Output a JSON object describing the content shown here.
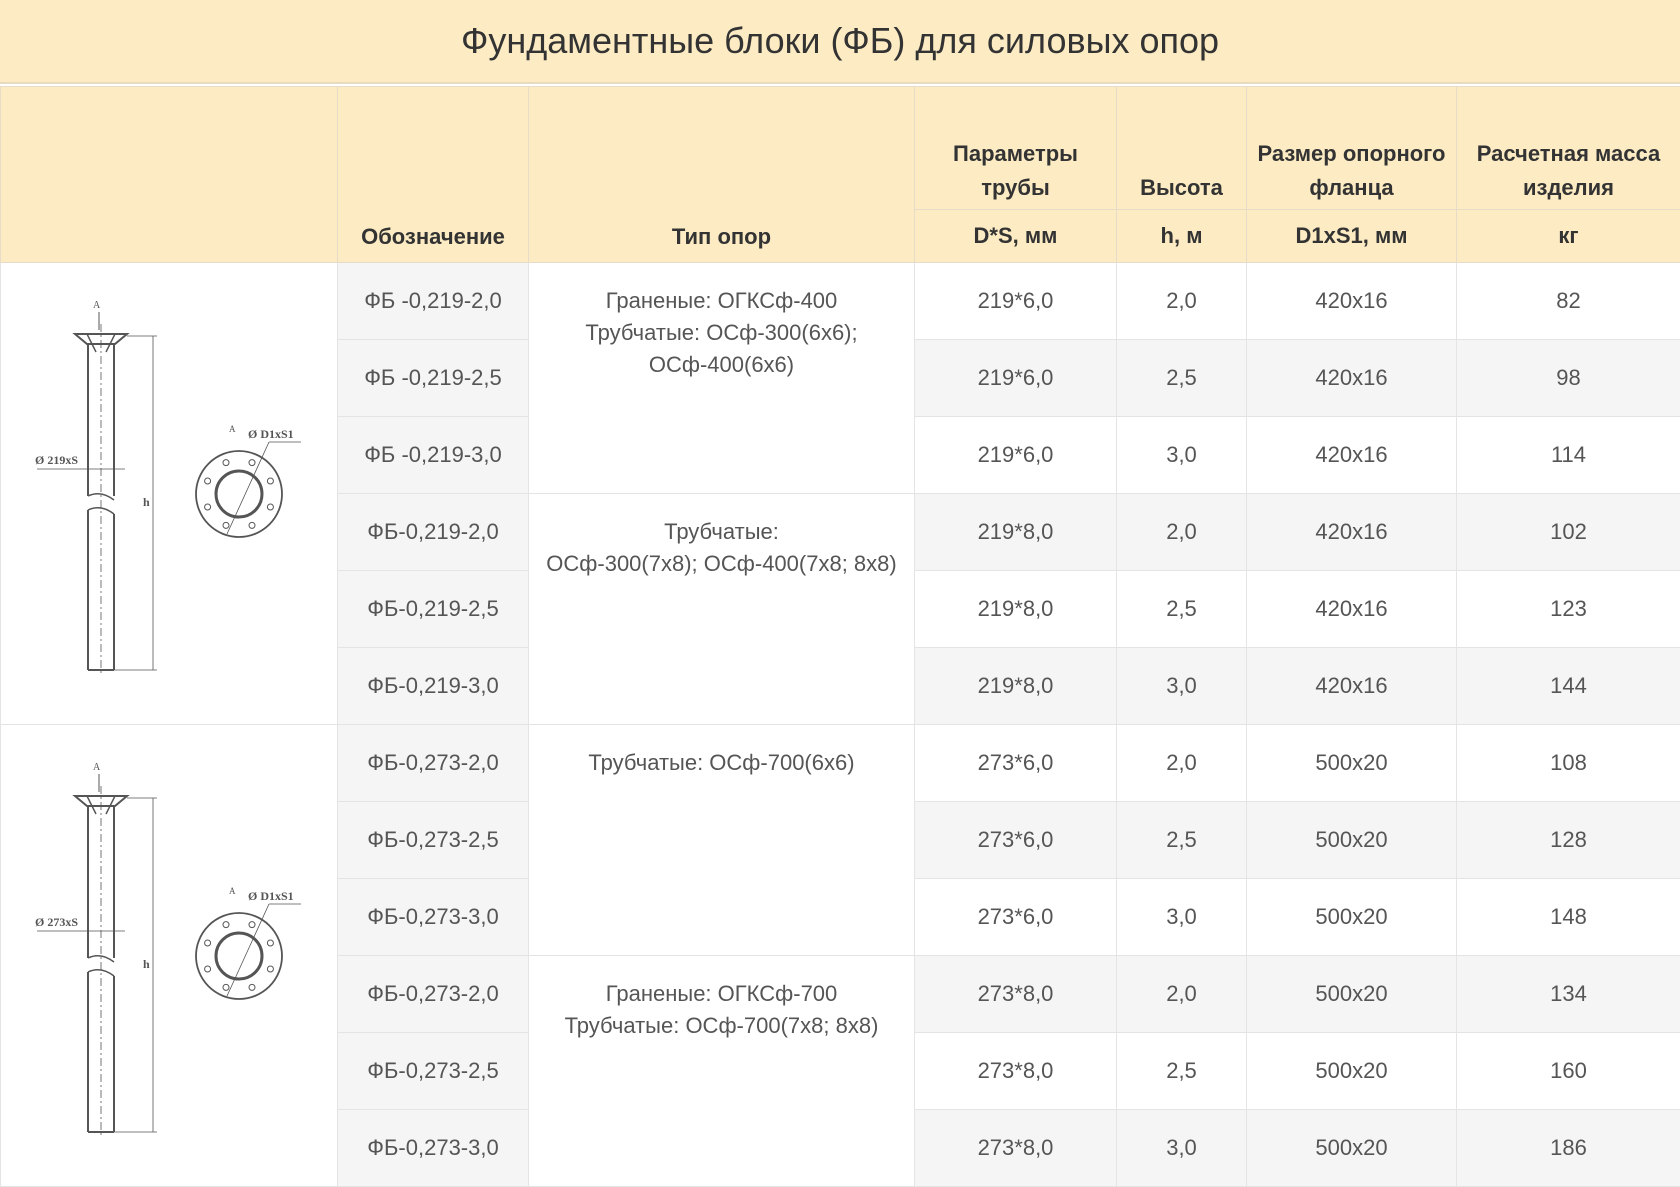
{
  "title": "Фундаментные блоки (ФБ) для силовых опор",
  "headers": {
    "designation": "Обозначение",
    "support_type": "Тип опор",
    "pipe_params": "Параметры трубы",
    "pipe_unit": "D*S, мм",
    "height": "Высота",
    "height_unit": "h, м",
    "flange": "Размер опорного фланца",
    "flange_unit": "D1xS1, мм",
    "mass": "Расчетная масса изделия",
    "mass_unit": "кг"
  },
  "drawings": [
    {
      "pipe_label": "Ø 219xS",
      "flange_label": "Ø D1xS1",
      "h_label": "h",
      "a_label": "А"
    },
    {
      "pipe_label": "Ø 273xS",
      "flange_label": "Ø D1xS1",
      "h_label": "h",
      "a_label": "А"
    }
  ],
  "groups": [
    {
      "type_lines": [
        "Граненые: ОГКСф-400",
        "Трубчатые: ОСф-300(6x6);",
        "ОСф-400(6x6)"
      ]
    },
    {
      "type_lines": [
        "Трубчатые:",
        "ОСф-300(7x8); ОСф-400(7x8; 8x8)"
      ]
    },
    {
      "type_lines": [
        "Трубчатые: ОСф-700(6x6)"
      ]
    },
    {
      "type_lines": [
        "Граненые: ОГКСф-700",
        "Трубчатые: ОСф-700(7x8; 8x8)"
      ]
    }
  ],
  "rows": [
    {
      "code": "ФБ -0,219-2,0",
      "pipe": "219*6,0",
      "height": "2,0",
      "flange": "420x16",
      "mass": "82"
    },
    {
      "code": "ФБ -0,219-2,5",
      "pipe": "219*6,0",
      "height": "2,5",
      "flange": "420x16",
      "mass": "98"
    },
    {
      "code": "ФБ -0,219-3,0",
      "pipe": "219*6,0",
      "height": "3,0",
      "flange": "420x16",
      "mass": "114"
    },
    {
      "code": "ФБ-0,219-2,0",
      "pipe": "219*8,0",
      "height": "2,0",
      "flange": "420x16",
      "mass": "102"
    },
    {
      "code": "ФБ-0,219-2,5",
      "pipe": "219*8,0",
      "height": "2,5",
      "flange": "420x16",
      "mass": "123"
    },
    {
      "code": "ФБ-0,219-3,0",
      "pipe": "219*8,0",
      "height": "3,0",
      "flange": "420x16",
      "mass": "144"
    },
    {
      "code": "ФБ-0,273-2,0",
      "pipe": "273*6,0",
      "height": "2,0",
      "flange": "500x20",
      "mass": "108"
    },
    {
      "code": "ФБ-0,273-2,5",
      "pipe": "273*6,0",
      "height": "2,5",
      "flange": "500x20",
      "mass": "128"
    },
    {
      "code": "ФБ-0,273-3,0",
      "pipe": "273*6,0",
      "height": "3,0",
      "flange": "500x20",
      "mass": "148"
    },
    {
      "code": "ФБ-0,273-2,0",
      "pipe": "273*8,0",
      "height": "2,0",
      "flange": "500x20",
      "mass": "134"
    },
    {
      "code": "ФБ-0,273-2,5",
      "pipe": "273*8,0",
      "height": "2,5",
      "flange": "500x20",
      "mass": "160"
    },
    {
      "code": "ФБ-0,273-3,0",
      "pipe": "273*8,0",
      "height": "3,0",
      "flange": "500x20",
      "mass": "186"
    }
  ]
}
